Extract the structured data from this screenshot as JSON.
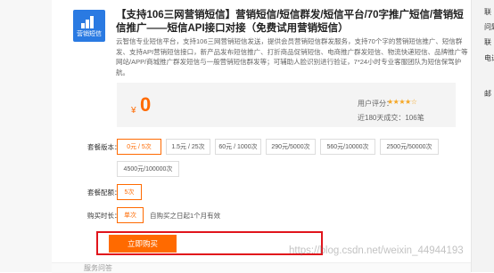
{
  "product": {
    "logo_text": "营销短信",
    "title": "【支持106三网营销短信】营销短信/短信群发/短信平台/70字推广短信/营销短信推广——短信API接口对接（免费试用营销短信）",
    "description": "云智信专业短信平台，支持106三网营销短信发送，提供会员营销短信群发服务，支持70个字的营销短信推广、短信群发、支持API营销短信接口，新产品发布短信推广、打折商品促销短信、电商推广群发短信、物流快递短信、品牌推广等网站/APP/商城推广群发短信与一般营销短信群发等；可辅助人脸识别进行验证，7*24小时专业客服团队为短信保驾护航。"
  },
  "pricing": {
    "currency": "¥",
    "price": "0",
    "rating_label": "用户评分：",
    "stars": "★★★★☆",
    "sales": "近180天成交：106笔"
  },
  "options": {
    "package_label": "套餐版本：",
    "packages": [
      "0元 / 5次",
      "1.5元 / 25次",
      "60元 / 1000次",
      "290元/5000次",
      "560元/10000次",
      "2500元/50000次",
      "4500元/100000次"
    ],
    "config_label": "套餐配额：",
    "config_value": "5次",
    "duration_label": "购买时长：",
    "duration_value": "单次",
    "duration_note": "自购买之日起1个月有效"
  },
  "actions": {
    "buy_label": "立即购买"
  },
  "bottom": {
    "text": "服务问答"
  },
  "right_panel": {
    "items": [
      "联",
      "问题",
      "联",
      "电话",
      "邮"
    ]
  },
  "watermark": "https://blog.csdn.net/weixin_44944193",
  "colors": {
    "accent": "#ff6a00",
    "highlight": "#e1141c",
    "logo_bg": "#2a7ae2"
  }
}
